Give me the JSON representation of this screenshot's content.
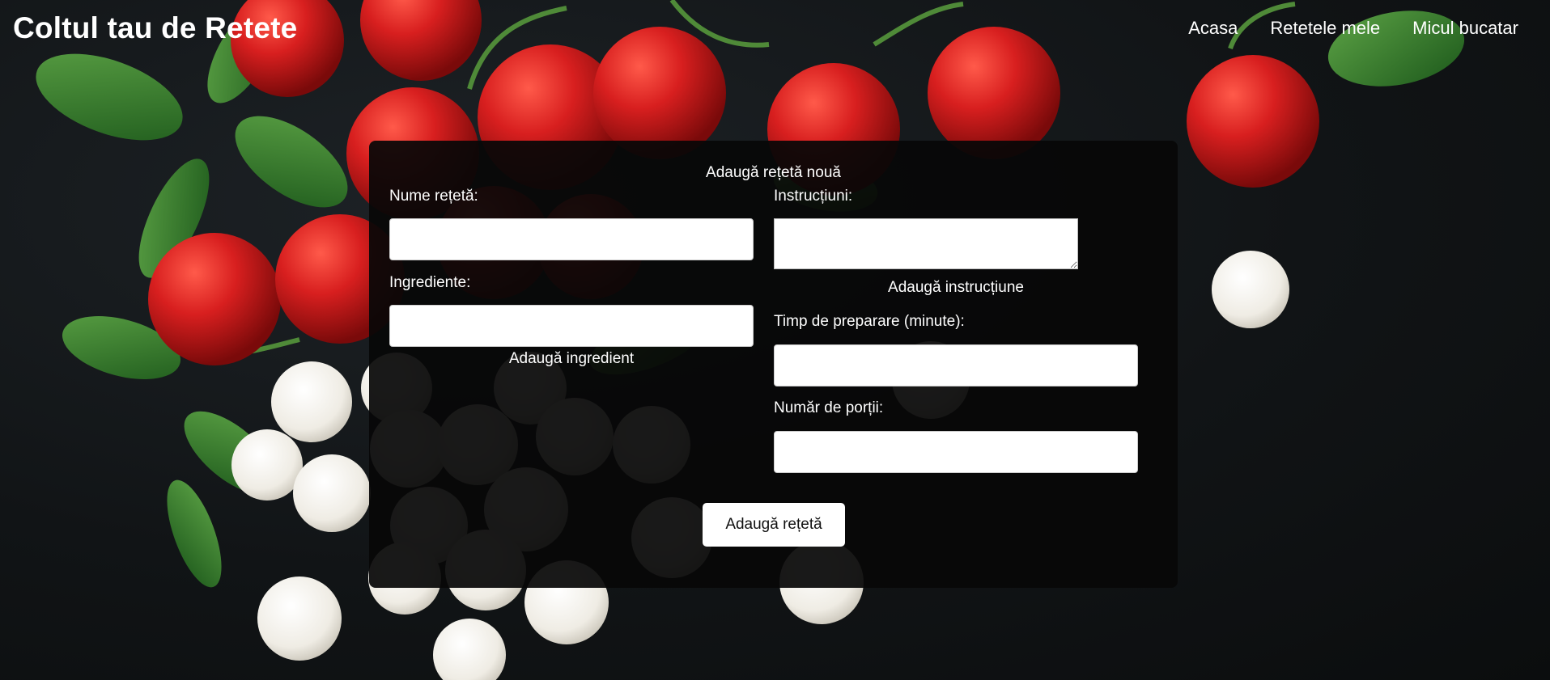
{
  "header": {
    "site_title": "Coltul tau de Retete"
  },
  "nav": {
    "items": [
      {
        "label": "Acasa"
      },
      {
        "label": "Retetele mele"
      },
      {
        "label": "Micul bucatar"
      }
    ]
  },
  "form": {
    "title": "Adaugă rețetă nouă",
    "recipe_name_label": "Nume rețetă:",
    "recipe_name_value": "",
    "ingredients_label": "Ingrediente:",
    "ingredient_value": "",
    "add_ingredient_label": "Adaugă ingredient",
    "instructions_label": "Instrucțiuni:",
    "instruction_value": "",
    "add_instruction_label": "Adaugă instrucțiune",
    "prep_time_label": "Timp de preparare (minute):",
    "prep_time_value": "",
    "servings_label": "Număr de porții:",
    "servings_value": "",
    "submit_label": "Adaugă rețetă"
  },
  "background": {
    "description_icons": [
      "tomato-icon",
      "basil-leaf-icon",
      "mozzarella-icon"
    ],
    "colors": {
      "backdrop": "#111416",
      "tomato": "#d81f1f",
      "basil": "#2f7a2a",
      "mozzarella": "#f2efe8",
      "panel": "#080808"
    }
  }
}
